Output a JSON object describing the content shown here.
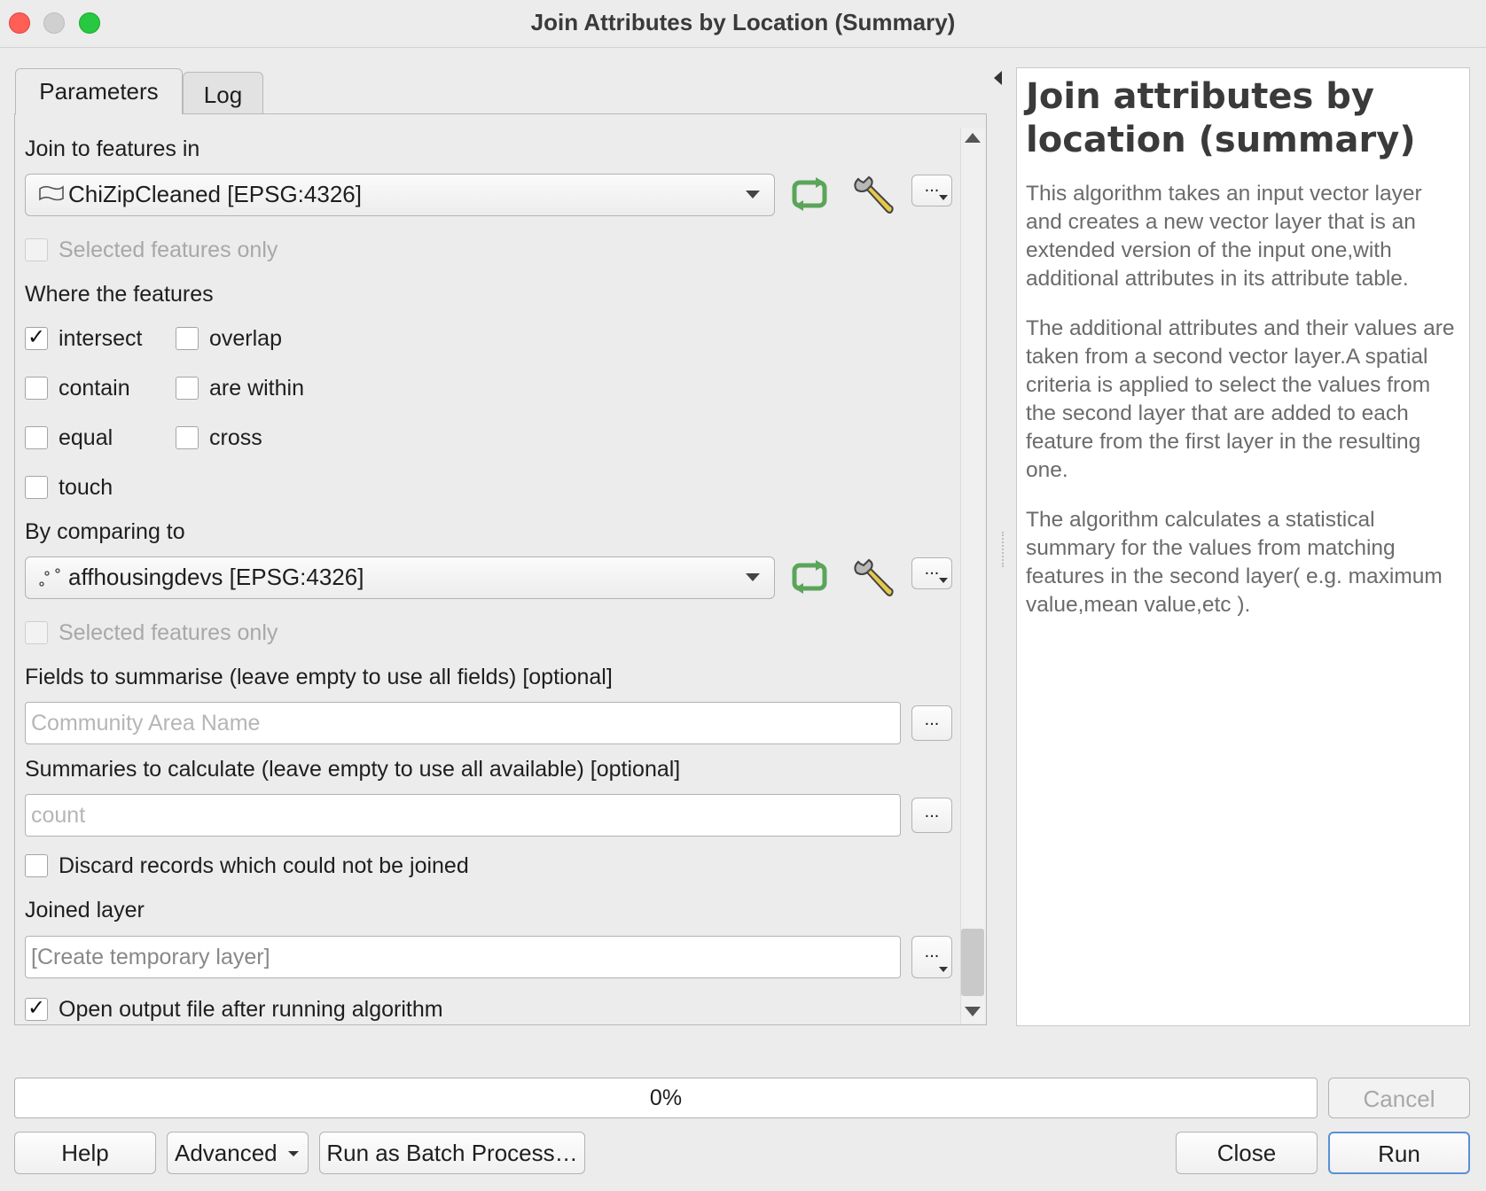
{
  "window": {
    "title": "Join Attributes by Location (Summary)"
  },
  "tabs": {
    "parameters": "Parameters",
    "log": "Log"
  },
  "form": {
    "join_label": "Join to features in",
    "join_layer": "ChiZipCleaned [EPSG:4326]",
    "selected_only": "Selected features only",
    "where_label": "Where the features",
    "predicates": {
      "intersect": "intersect",
      "overlap": "overlap",
      "contain": "contain",
      "are_within": "are within",
      "equal": "equal",
      "cross": "cross",
      "touch": "touch"
    },
    "predicates_checked": [
      "intersect"
    ],
    "compare_label": "By comparing to",
    "compare_layer": "affhousingdevs [EPSG:4326]",
    "fields_label": "Fields to summarise (leave empty to use all fields) [optional]",
    "fields_value": "Community Area Name",
    "summaries_label": "Summaries to calculate (leave empty to use all available) [optional]",
    "summaries_value": "count",
    "discard_label": "Discard records which could not be joined",
    "joined_label": "Joined layer",
    "joined_value": "[Create temporary layer]",
    "open_output_label": "Open output file after running algorithm",
    "open_output_checked": true,
    "ellipsis": "..."
  },
  "help": {
    "title": "Join attributes by location (summary)",
    "paragraphs": [
      "This algorithm takes an input vector layer and creates a new vector layer that is an extended version of the input one,with additional attributes in its attribute table.",
      "The additional attributes and their values are taken from a second vector layer.A spatial criteria is applied to select the values from the second layer that are added to each feature from the first layer in the resulting one.",
      "The algorithm calculates a statistical summary for the values from matching features in the second layer( e.g. maximum value,mean value,etc )."
    ]
  },
  "footer": {
    "progress": "0%",
    "progress_value": 0,
    "cancel": "Cancel",
    "help": "Help",
    "advanced": "Advanced",
    "batch": "Run as Batch Process…",
    "close": "Close",
    "run": "Run"
  },
  "colors": {
    "accent": "#5b8fd6",
    "refresh_green": "#5aa55a",
    "wrench_yellow": "#e6c84a"
  }
}
